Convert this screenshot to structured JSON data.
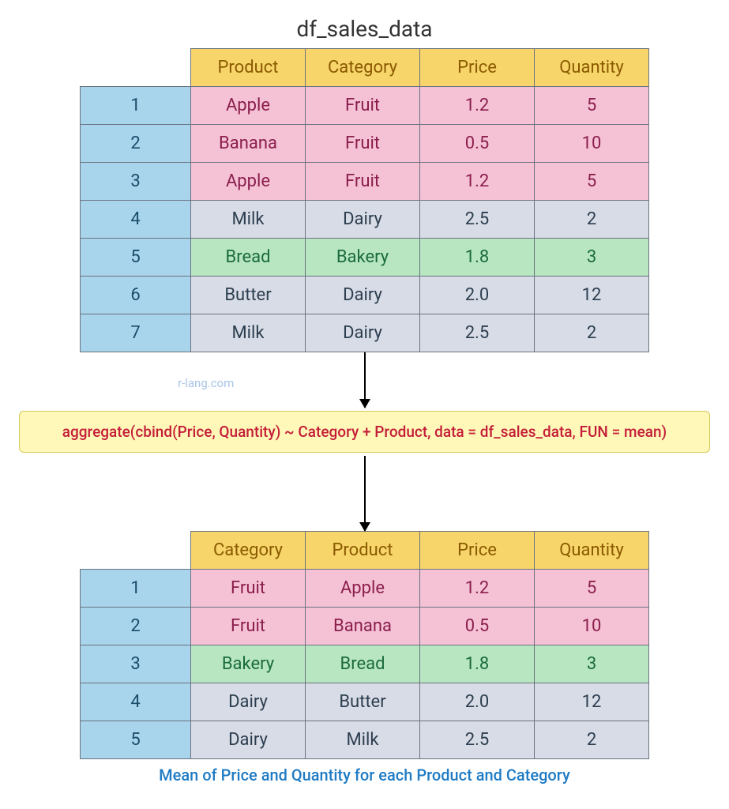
{
  "title": "df_sales_data",
  "watermark": "r-lang.com",
  "code": "aggregate(cbind(Price, Quantity) ~ Category + Product, data = df_sales_data, FUN = mean)",
  "caption": "Mean of Price and Quantity for each Product and Category",
  "table1": {
    "headers": [
      "Product",
      "Category",
      "Price",
      "Quantity"
    ],
    "rows": [
      {
        "idx": "1",
        "cells": [
          "Apple",
          "Fruit",
          "1.2",
          "5"
        ],
        "style": "pink"
      },
      {
        "idx": "2",
        "cells": [
          "Banana",
          "Fruit",
          "0.5",
          "10"
        ],
        "style": "pink"
      },
      {
        "idx": "3",
        "cells": [
          "Apple",
          "Fruit",
          "1.2",
          "5"
        ],
        "style": "pink"
      },
      {
        "idx": "4",
        "cells": [
          "Milk",
          "Dairy",
          "2.5",
          "2"
        ],
        "style": "gray"
      },
      {
        "idx": "5",
        "cells": [
          "Bread",
          "Bakery",
          "1.8",
          "3"
        ],
        "style": "green"
      },
      {
        "idx": "6",
        "cells": [
          "Butter",
          "Dairy",
          "2.0",
          "12"
        ],
        "style": "gray"
      },
      {
        "idx": "7",
        "cells": [
          "Milk",
          "Dairy",
          "2.5",
          "2"
        ],
        "style": "gray"
      }
    ]
  },
  "table2": {
    "headers": [
      "Category",
      "Product",
      "Price",
      "Quantity"
    ],
    "rows": [
      {
        "idx": "1",
        "cells": [
          "Fruit",
          "Apple",
          "1.2",
          "5"
        ],
        "style": "pink"
      },
      {
        "idx": "2",
        "cells": [
          "Fruit",
          "Banana",
          "0.5",
          "10"
        ],
        "style": "pink"
      },
      {
        "idx": "3",
        "cells": [
          "Bakery",
          "Bread",
          "1.8",
          "3"
        ],
        "style": "green"
      },
      {
        "idx": "4",
        "cells": [
          "Dairy",
          "Butter",
          "2.0",
          "12"
        ],
        "style": "gray"
      },
      {
        "idx": "5",
        "cells": [
          "Dairy",
          "Milk",
          "2.5",
          "2"
        ],
        "style": "gray"
      }
    ]
  }
}
